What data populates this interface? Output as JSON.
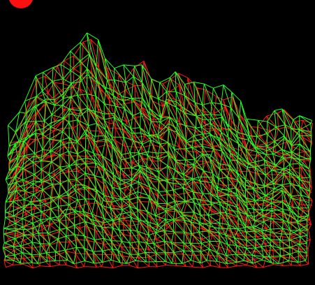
{
  "scene": {
    "background_color": "#000000",
    "record_indicator_color": "#ff1010",
    "mesh_layers": [
      {
        "name": "mesh-red",
        "color": "#ff1a1a"
      },
      {
        "name": "mesh-green",
        "color": "#22ff22"
      }
    ]
  }
}
